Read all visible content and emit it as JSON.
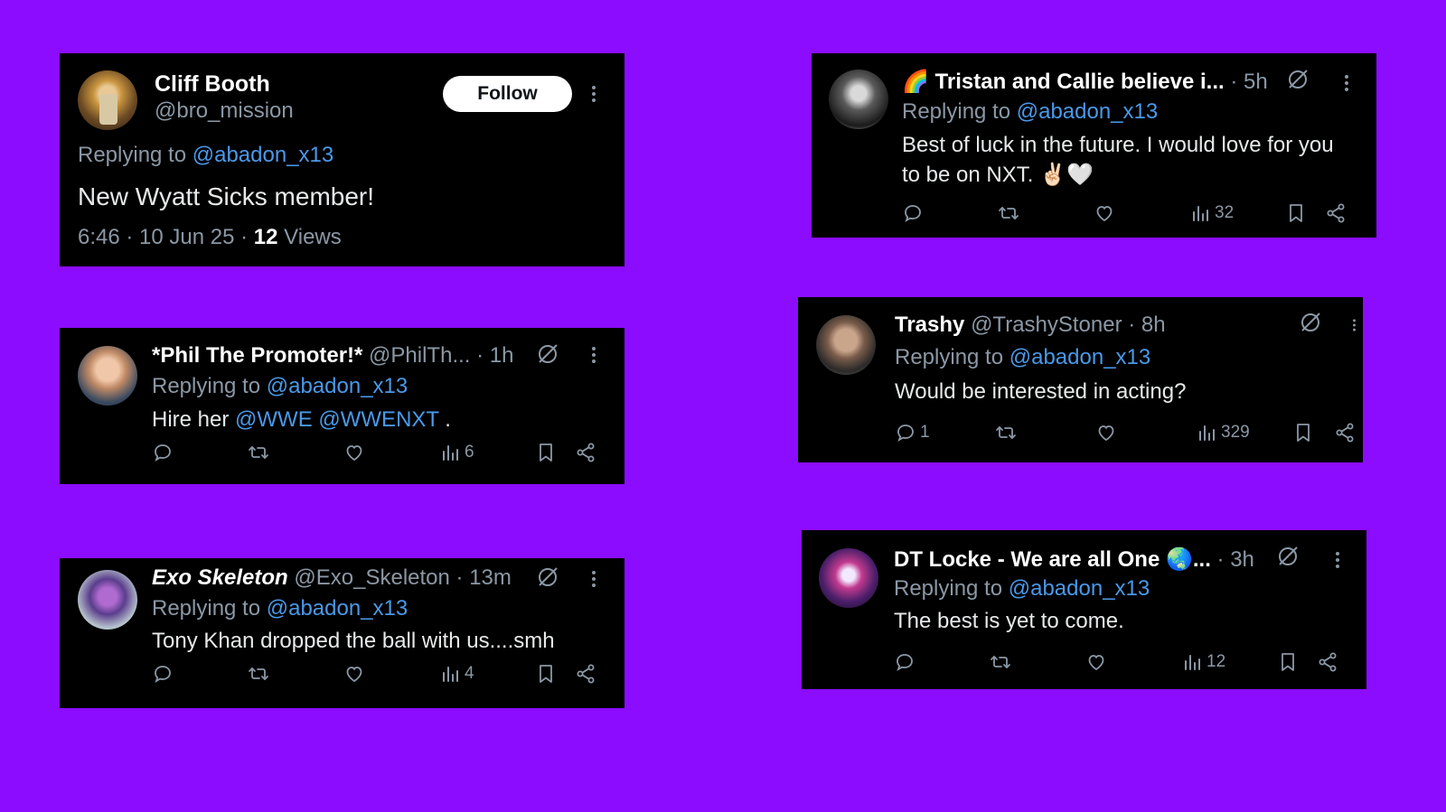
{
  "colors": {
    "background": "#8c0cff",
    "card": "#000000",
    "link": "#4a99e9",
    "muted": "#8b98a5"
  },
  "cards": {
    "cliff": {
      "name": "Cliff Booth",
      "handle": "@bro_mission",
      "follow_label": "Follow",
      "replying_prefix": "Replying to",
      "replying_handle": "@abadon_x13",
      "text": "New Wyatt Sicks member!",
      "meta_prefix": "6:46 · 10 Jun 25 · ",
      "views_count": "12",
      "views_label": " Views"
    },
    "phil": {
      "name": "*Phil The Promoter!*",
      "handle": "@PhilTh...",
      "time": "· 1h",
      "replying_prefix": "Replying to",
      "replying_handle": "@abadon_x13",
      "text_prefix": "Hire her",
      "mention1": "@WWE",
      "mention2": "@WWENXT",
      "text_suffix": " .",
      "views": "6"
    },
    "exo": {
      "name": "Exo Skeleton",
      "handle": "@Exo_Skeleton",
      "time": "· 13m",
      "replying_prefix": "Replying to",
      "replying_handle": "@abadon_x13",
      "text": "Tony Khan dropped the ball with us....smh",
      "views": "4"
    },
    "tristan": {
      "name": "🌈 Tristan and Callie believe i...",
      "time": "· 5h",
      "replying_prefix": "Replying to",
      "replying_handle": "@abadon_x13",
      "text_line1": "Best of luck in the future. I would love for you",
      "text_line2": "to be on NXT. ✌🏻🤍",
      "views": "32"
    },
    "trashy": {
      "name": "Trashy",
      "handle": "@TrashyStoner",
      "time": "· 8h",
      "replying_prefix": "Replying to",
      "replying_handle": "@abadon_x13",
      "text": "Would be interested in acting?",
      "replies": "1",
      "views": "329"
    },
    "dt": {
      "name": "DT Locke - We are all One 🌏...",
      "time": "· 3h",
      "replying_prefix": "Replying to",
      "replying_handle": "@abadon_x13",
      "text": "The best is yet to come.",
      "views": "12"
    }
  },
  "icons": [
    "reply-icon",
    "repost-icon",
    "like-icon",
    "views-icon",
    "bookmark-icon",
    "share-icon",
    "grok-icon",
    "more-icon"
  ]
}
